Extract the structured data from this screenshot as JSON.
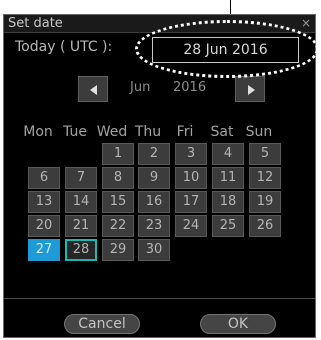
{
  "dialog": {
    "title": "Set date",
    "close_glyph": "×",
    "today_label": "Today ( UTC ):",
    "today_value": "28 Jun 2016",
    "nav": {
      "prev_icon": "left-triangle-icon",
      "next_icon": "right-triangle-icon",
      "month": "Jun",
      "year": "2016"
    },
    "weekdays": [
      "Mon",
      "Tue",
      "Wed",
      "Thu",
      "Fri",
      "Sat",
      "Sun"
    ],
    "days": [
      "1",
      "2",
      "3",
      "4",
      "5",
      "6",
      "7",
      "8",
      "9",
      "10",
      "11",
      "12",
      "13",
      "14",
      "15",
      "16",
      "17",
      "18",
      "19",
      "20",
      "21",
      "22",
      "23",
      "24",
      "25",
      "26",
      "27",
      "28",
      "29",
      "30"
    ],
    "first_weekday_index": 2,
    "selected_day": "27",
    "today_day": "28",
    "buttons": {
      "cancel": "Cancel",
      "ok": "OK"
    },
    "colors": {
      "background": "#000000",
      "cell": "#3c3c3c",
      "selected": "#1e9ad6",
      "today_outline": "#1bb9b0"
    }
  }
}
